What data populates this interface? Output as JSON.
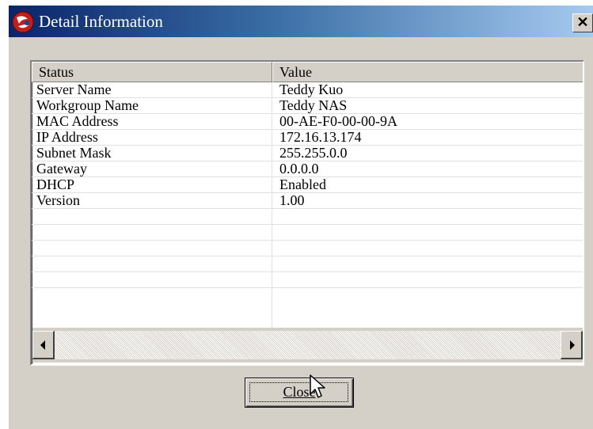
{
  "window": {
    "title": "Detail Information",
    "close_glyph": "✕",
    "icon": "app-logo-icon"
  },
  "table": {
    "columns": [
      "Status",
      "Value"
    ],
    "rows": [
      [
        "Server Name",
        "Teddy Kuo"
      ],
      [
        "Workgroup Name",
        "Teddy NAS"
      ],
      [
        "MAC Address",
        "00-AE-F0-00-00-9A"
      ],
      [
        "IP Address",
        "172.16.13.174"
      ],
      [
        "Subnet Mask",
        "255.255.0.0"
      ],
      [
        "Gateway",
        "0.0.0.0"
      ],
      [
        "DHCP",
        "Enabled"
      ],
      [
        "Version",
        "1.00"
      ],
      [
        "",
        ""
      ],
      [
        "",
        ""
      ],
      [
        "",
        ""
      ],
      [
        "",
        ""
      ],
      [
        "",
        ""
      ]
    ]
  },
  "scrollbar": {
    "left_icon": "scroll-left-arrow-icon",
    "right_icon": "scroll-right-arrow-icon"
  },
  "buttons": {
    "close_label": "Close"
  },
  "colors": {
    "title_gradient_start": "#0a246a",
    "title_gradient_end": "#a6caf0",
    "dialog_face": "#d4d0c8"
  }
}
